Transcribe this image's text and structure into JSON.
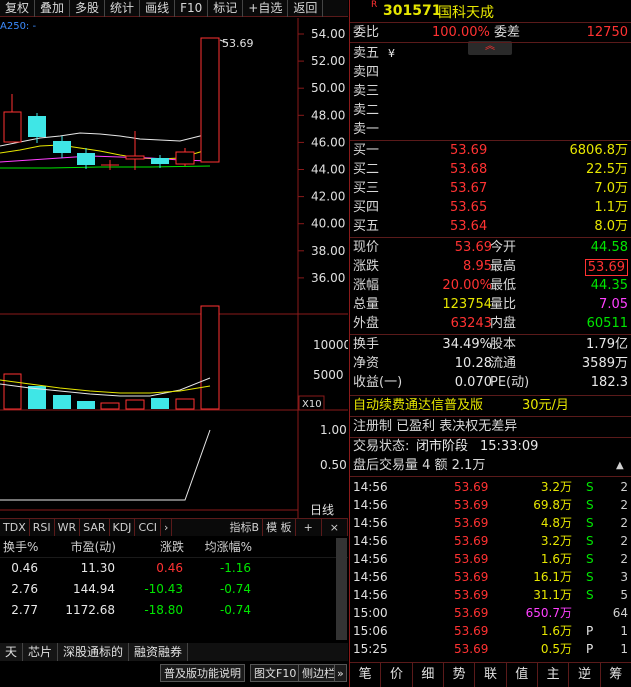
{
  "toolbar": [
    "复权",
    "叠加",
    "多股",
    "统计",
    "画线",
    "F10",
    "标记",
    "+自选",
    "返回"
  ],
  "chart": {
    "ma_label": "A250: -",
    "max_price_label": "53.69",
    "price_ticks": [
      "54.00",
      "52.00",
      "50.00",
      "48.00",
      "46.00",
      "44.00",
      "42.00",
      "40.00",
      "38.00",
      "36.00"
    ],
    "volume_ticks": [
      "10000",
      "5000"
    ],
    "volume_unit": "X10",
    "ind_ticks": [
      "1.00",
      "0.50"
    ],
    "period_label": "日线"
  },
  "indicator_tabs": [
    "TDX",
    "RSI",
    "WR",
    "SAR",
    "KDJ",
    "CCI",
    "›",
    "指标B",
    "模 板",
    "+",
    "×"
  ],
  "mini_table": {
    "headers": [
      "换手%",
      "市盈(动)",
      "涨跌",
      "均涨幅%"
    ],
    "rows": [
      {
        "turnover": "0.46",
        "pe": "11.30",
        "change": "0.46",
        "avg": "-1.16"
      },
      {
        "turnover": "2.76",
        "pe": "144.94",
        "change": "-10.43",
        "avg": "-0.74"
      },
      {
        "turnover": "2.77",
        "pe": "1172.68",
        "change": "-18.80",
        "avg": "-0.74"
      }
    ]
  },
  "bottom_tabs": [
    "天",
    "芯片",
    "深股通标的",
    "融资融券"
  ],
  "status_strip": [
    "普及版功能说明",
    "图文F10",
    "侧边栏",
    "»"
  ],
  "stock": {
    "badge": "R",
    "code": "301571",
    "name": "国科天成"
  },
  "weibi": {
    "label": "委比",
    "value": "100.00%",
    "label2": "委差",
    "value2": "12750"
  },
  "asks": [
    {
      "label": "卖五",
      "mark": "¥"
    },
    {
      "label": "卖四"
    },
    {
      "label": "卖三"
    },
    {
      "label": "卖二"
    },
    {
      "label": "卖一"
    }
  ],
  "bids": [
    {
      "label": "买一",
      "price": "53.69",
      "vol": "6806.8万"
    },
    {
      "label": "买二",
      "price": "53.68",
      "vol": "22.5万"
    },
    {
      "label": "买三",
      "price": "53.67",
      "vol": "7.0万"
    },
    {
      "label": "买四",
      "price": "53.65",
      "vol": "1.1万"
    },
    {
      "label": "买五",
      "price": "53.64",
      "vol": "8.0万"
    }
  ],
  "quote": [
    {
      "l1": "现价",
      "v1": "53.69",
      "l2": "今开",
      "v2": "44.58"
    },
    {
      "l1": "涨跌",
      "v1": "8.95",
      "l2": "最高",
      "v2": "53.69"
    },
    {
      "l1": "涨幅",
      "v1": "20.00%",
      "l2": "最低",
      "v2": "44.35"
    },
    {
      "l1": "总量",
      "v1": "123754",
      "l2": "量比",
      "v2": "7.05"
    },
    {
      "l1": "外盘",
      "v1": "63243",
      "l2": "内盘",
      "v2": "60511"
    }
  ],
  "fundamentals": [
    {
      "l1": "换手",
      "v1": "34.49%",
      "l2": "股本",
      "v2": "1.79亿"
    },
    {
      "l1": "净资",
      "v1": "10.28",
      "l2": "流通",
      "v2": "3589万"
    },
    {
      "l1": "收益(一)",
      "v1": "0.070",
      "l2": "PE(动)",
      "v2": "182.3"
    }
  ],
  "ad": {
    "text": "自动续费通达信普及版",
    "price": "30元/月"
  },
  "reg": "注册制 已盈利 表决权无差异",
  "trade_status": {
    "label": "交易状态:",
    "value": "闭市阶段",
    "time": "15:33:09"
  },
  "after_hours": {
    "text": "盘后交易量 4 额 2.1万"
  },
  "trades": [
    {
      "time": "14:56",
      "price": "53.69",
      "vol": "3.2万",
      "flag": "S",
      "n": "2"
    },
    {
      "time": "14:56",
      "price": "53.69",
      "vol": "69.8万",
      "flag": "S",
      "n": "2"
    },
    {
      "time": "14:56",
      "price": "53.69",
      "vol": "4.8万",
      "flag": "S",
      "n": "2"
    },
    {
      "time": "14:56",
      "price": "53.69",
      "vol": "3.2万",
      "flag": "S",
      "n": "2"
    },
    {
      "time": "14:56",
      "price": "53.69",
      "vol": "1.6万",
      "flag": "S",
      "n": "2"
    },
    {
      "time": "14:56",
      "price": "53.69",
      "vol": "16.1万",
      "flag": "S",
      "n": "3"
    },
    {
      "time": "14:56",
      "price": "53.69",
      "vol": "31.1万",
      "flag": "S",
      "n": "5"
    },
    {
      "time": "15:00",
      "price": "53.69",
      "vol": "650.7万",
      "flag": "",
      "n": "64"
    },
    {
      "time": "15:06",
      "price": "53.69",
      "vol": "1.6万",
      "flag": "P",
      "n": "1"
    },
    {
      "time": "15:25",
      "price": "53.69",
      "vol": "0.5万",
      "flag": "P",
      "n": "1"
    }
  ],
  "rp_bottom_tabs": [
    "笔",
    "价",
    "细",
    "势",
    "联",
    "值",
    "主",
    "逆",
    "筹"
  ],
  "colors": {
    "up": "#ff3232",
    "down": "#00e600",
    "candle_down": "#3fe6e6",
    "border": "#8a1a1a"
  }
}
